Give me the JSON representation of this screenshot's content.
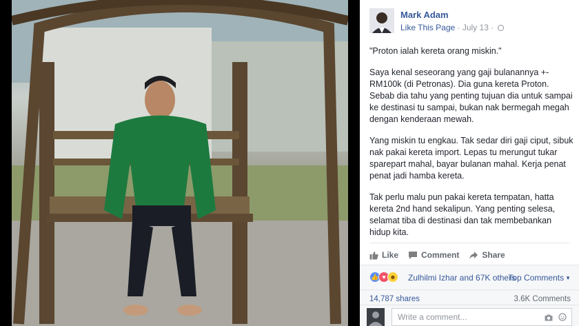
{
  "post": {
    "author": "Mark Adam",
    "like_page": "Like This Page",
    "separator": " · ",
    "date": "July 13",
    "separator2": " · ",
    "paragraphs": [
      "\"Proton ialah kereta orang miskin.\"",
      "Saya kenal seseorang yang gaji bulanannya +- RM100k (di Petronas). Dia guna kereta Proton. Sebab dia tahu yang penting tujuan dia untuk sampai ke destinasi tu sampai, bukan nak bermegah megah dengan kenderaan mewah.",
      "Yang miskin tu engkau. Tak sedar diri gaji ciput, sibuk nak pakai kereta import. Lepas tu merungut tukar sparepart mahal, bayar bulanan mahal. Kerja penat penat jadi hamba kereta.",
      "Tak perlu malu pun pakai kereta tempatan, hatta kereta 2nd hand sekalipun. Yang penting selesa, selamat tiba di destinasi dan tak membebankan hidup kita."
    ]
  },
  "actions": {
    "like": "Like",
    "comment": "Comment",
    "share": "Share"
  },
  "reactions": {
    "summary": "Zulhilmi Izhar and 67K others",
    "top_comments": "Top Comments",
    "icons": [
      "like-reaction-icon",
      "love-reaction-icon",
      "haha-reaction-icon"
    ]
  },
  "stats": {
    "shares": "14,787 shares",
    "comments": "3.6K Comments"
  },
  "comment_box": {
    "placeholder": "Write a comment..."
  },
  "colors": {
    "link": "#365899",
    "meta": "#90949c",
    "text": "#1d2129",
    "panel_bg": "#ffffff",
    "footer_bg": "#f6f7f9"
  }
}
